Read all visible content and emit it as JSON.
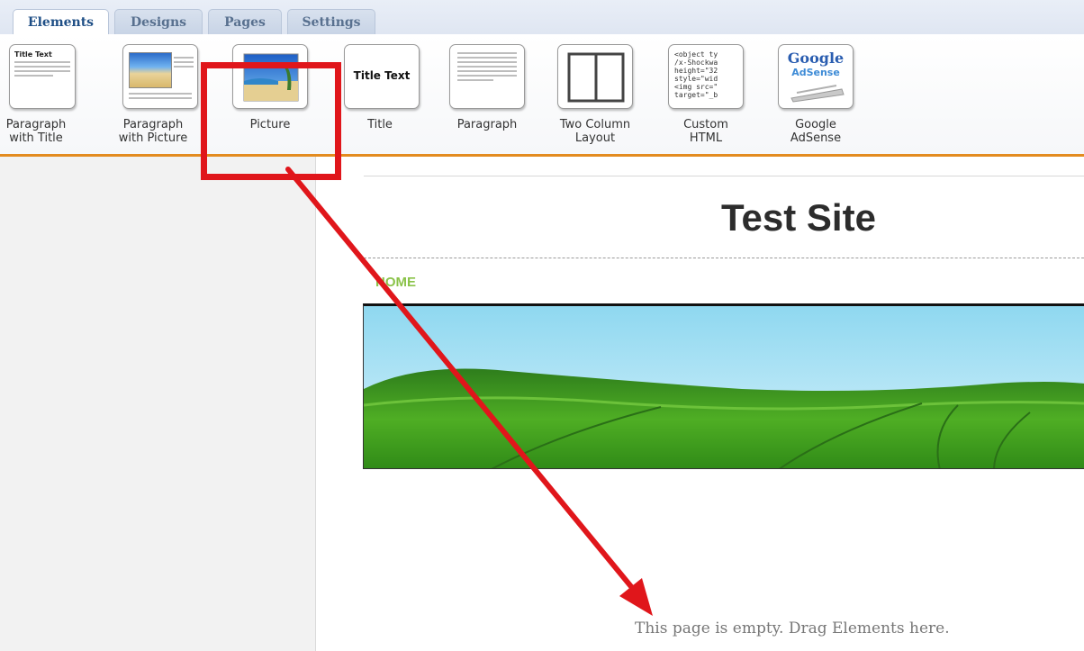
{
  "tabs": [
    {
      "label": "Elements",
      "active": true
    },
    {
      "label": "Designs",
      "active": false
    },
    {
      "label": "Pages",
      "active": false
    },
    {
      "label": "Settings",
      "active": false
    }
  ],
  "toolbar": {
    "items": [
      {
        "label": "Paragraph\nwith Title",
        "thumb_title": "Title Text",
        "icon": "paragraph-with-title-icon"
      },
      {
        "label": "Paragraph\nwith Picture",
        "icon": "paragraph-with-picture-icon"
      },
      {
        "label": "Picture",
        "icon": "picture-icon",
        "highlighted": true
      },
      {
        "label": "Title",
        "thumb_title": "Title Text",
        "icon": "title-icon"
      },
      {
        "label": "Paragraph",
        "icon": "paragraph-icon"
      },
      {
        "label": "Two Column\nLayout",
        "icon": "two-column-layout-icon"
      },
      {
        "label": "Custom\nHTML",
        "icon": "custom-html-icon",
        "thumb_code": "<object ty\n/x-Shockwa\nheight=\"32\nstyle=\"wid\n<img src=\"\ntarget=\"_b"
      },
      {
        "label": "Google\nAdSense",
        "icon": "google-adsense-icon",
        "thumb_brand": "Google",
        "thumb_sub": "AdSense"
      }
    ]
  },
  "canvas": {
    "site_title": "Test Site",
    "nav_home": "HOME",
    "empty_message": "This page is empty. Drag Elements here."
  },
  "colors": {
    "accent_orange": "#e38b1f",
    "highlight_red": "#e0161b",
    "home_green": "#8bc34a",
    "tab_text": "#1f4f86"
  }
}
